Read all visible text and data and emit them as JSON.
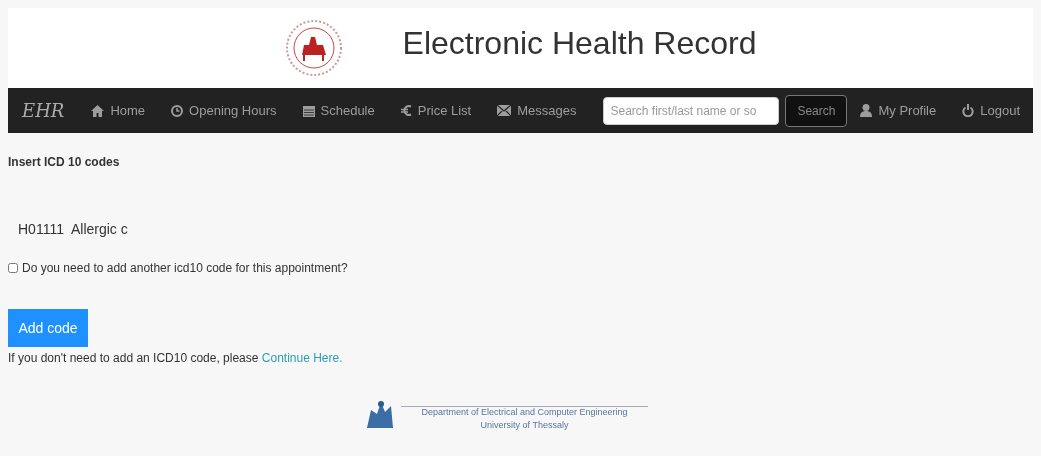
{
  "header": {
    "title": "Electronic Health Record"
  },
  "navbar": {
    "brand": "EHR",
    "items": [
      {
        "label": "Home"
      },
      {
        "label": "Opening Hours"
      },
      {
        "label": "Schedule"
      },
      {
        "label": "Price List"
      },
      {
        "label": "Messages"
      }
    ],
    "search": {
      "placeholder": "Search first/last name or so",
      "button": "Search"
    },
    "right_items": [
      {
        "label": "My Profile"
      },
      {
        "label": "Logout"
      }
    ]
  },
  "form": {
    "heading": "Insert ICD 10 codes",
    "code_value": "H01111  Allergic c",
    "another_code": {
      "label": "Do you need to add another icd10 code for this appointment?",
      "checked": false
    },
    "button": "Add code",
    "note": "If you don't need to add an ICD10 code, please ",
    "link": "Continue Here."
  },
  "footer": {
    "line_1": "Department of Electrical and Computer Engineering",
    "line_2": "University of Thessaly"
  }
}
